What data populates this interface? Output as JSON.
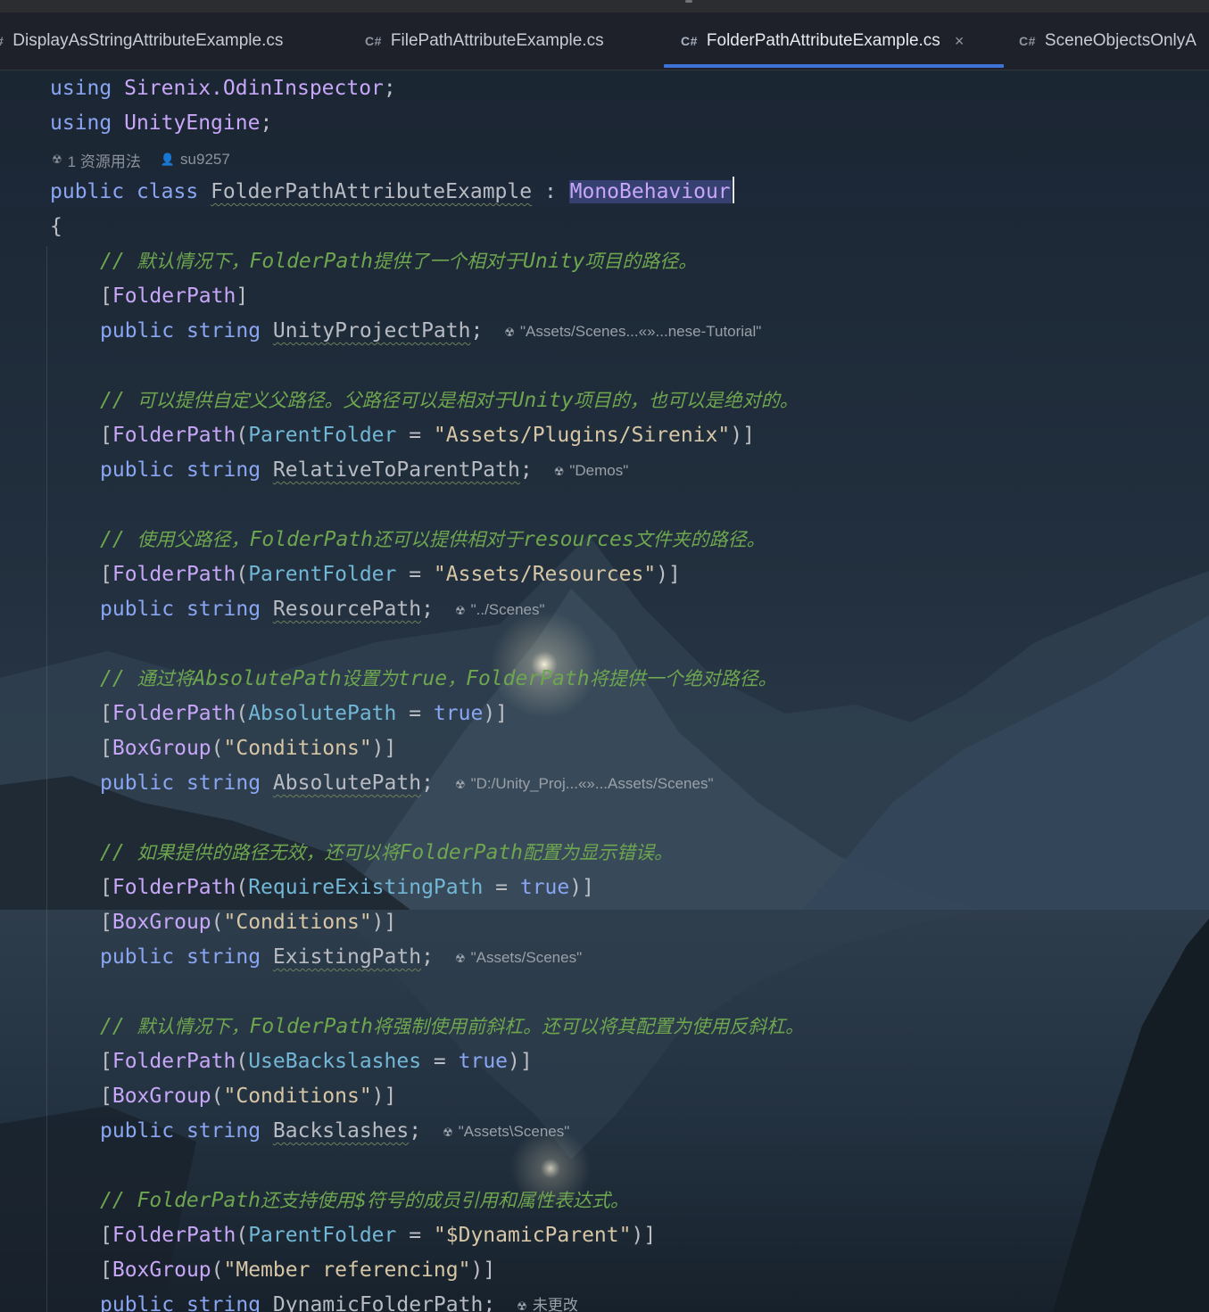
{
  "tabs": [
    {
      "lang": "#",
      "label": "DisplayAsStringAttributeExample.cs",
      "active": false
    },
    {
      "lang": "C#",
      "label": "FilePathAttributeExample.cs",
      "active": false
    },
    {
      "lang": "C#",
      "label": "FolderPathAttributeExample.cs",
      "active": true,
      "close": "×"
    },
    {
      "lang": "C#",
      "label": "SceneObjectsOnlyA",
      "active": false
    }
  ],
  "code": {
    "using1": {
      "kw": "using",
      "ns": "Sirenix.OdinInspector",
      "end": ";"
    },
    "using2": {
      "kw": "using",
      "ns": "UnityEngine",
      "end": ";"
    },
    "usage_hint": {
      "icon": "asset-icon",
      "usages": "1 资源用法",
      "author_icon": "person-icon",
      "author": "su9257"
    },
    "class_decl": {
      "kw1": "public",
      "kw2": "class",
      "name": "FolderPathAttributeExample",
      "colon": " : ",
      "base": "MonoBehaviour"
    },
    "open_brace": "{",
    "blocks": [
      {
        "comment": "// 默认情况下，FolderPath提供了一个相对于Unity项目的路径。",
        "attrs": [
          {
            "name": "FolderPath"
          }
        ],
        "field": {
          "kw1": "public",
          "kw2": "string",
          "name": "UnityProjectPath",
          "hint": "\"Assets/Scenes...«»...nese-Tutorial\""
        }
      },
      {
        "comment": "// 可以提供自定义父路径。父路径可以是相对于Unity项目的，也可以是绝对的。",
        "attrs": [
          {
            "name": "FolderPath",
            "param": "ParentFolder",
            "op": " = ",
            "value": "\"Assets/Plugins/Sirenix\""
          }
        ],
        "field": {
          "kw1": "public",
          "kw2": "string",
          "name": "RelativeToParentPath",
          "hint": "\"Demos\""
        }
      },
      {
        "comment": "// 使用父路径，FolderPath还可以提供相对于resources文件夹的路径。",
        "attrs": [
          {
            "name": "FolderPath",
            "param": "ParentFolder",
            "op": " = ",
            "value": "\"Assets/Resources\""
          }
        ],
        "field": {
          "kw1": "public",
          "kw2": "string",
          "name": "ResourcePath",
          "hint": "\"../Scenes\""
        }
      },
      {
        "comment": "// 通过将AbsolutePath设置为true，FolderPath将提供一个绝对路径。",
        "attrs": [
          {
            "name": "FolderPath",
            "param": "AbsolutePath",
            "op": " = ",
            "kwvalue": "true"
          },
          {
            "name": "BoxGroup",
            "value": "\"Conditions\""
          }
        ],
        "field": {
          "kw1": "public",
          "kw2": "string",
          "name": "AbsolutePath",
          "hint": "\"D:/Unity_Proj...«»...Assets/Scenes\""
        }
      },
      {
        "comment": "// 如果提供的路径无效，还可以将FolderPath配置为显示错误。",
        "attrs": [
          {
            "name": "FolderPath",
            "param": "RequireExistingPath",
            "op": " = ",
            "kwvalue": "true"
          },
          {
            "name": "BoxGroup",
            "value": "\"Conditions\""
          }
        ],
        "field": {
          "kw1": "public",
          "kw2": "string",
          "name": "ExistingPath",
          "hint": "\"Assets/Scenes\""
        }
      },
      {
        "comment": "// 默认情况下，FolderPath将强制使用前斜杠。还可以将其配置为使用反斜杠。",
        "attrs": [
          {
            "name": "FolderPath",
            "param": "UseBackslashes",
            "op": " = ",
            "kwvalue": "true"
          },
          {
            "name": "BoxGroup",
            "value": "\"Conditions\""
          }
        ],
        "field": {
          "kw1": "public",
          "kw2": "string",
          "name": "Backslashes",
          "hint": "\"Assets\\Scenes\""
        }
      },
      {
        "comment": "// FolderPath还支持使用$符号的成员引用和属性表达式。",
        "attrs": [
          {
            "name": "FolderPath",
            "param": "ParentFolder",
            "op": " = ",
            "value": "\"$DynamicParent\""
          },
          {
            "name": "BoxGroup",
            "value": "\"Member referencing\""
          }
        ],
        "field": {
          "kw1": "public",
          "kw2": "string",
          "name": "DynamicFolderPath",
          "hint": "未更改"
        }
      }
    ]
  },
  "colors": {
    "keyword": "#8aa6f2",
    "type_name": "#c8a6f8",
    "parameter": "#72b7d6",
    "string": "#d7c6a5",
    "comment": "#6ea64f",
    "accent": "#3d73d6"
  }
}
